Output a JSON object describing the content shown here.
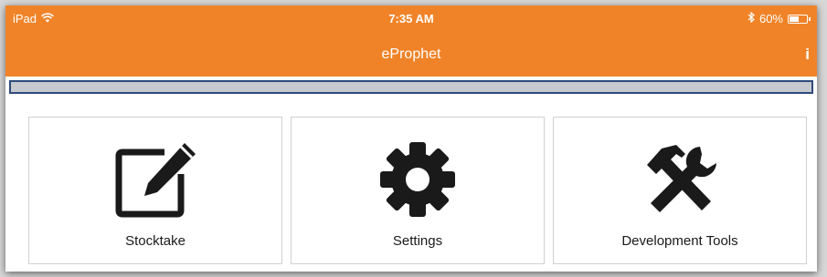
{
  "status": {
    "device": "iPad",
    "time": "7:35 AM",
    "battery_text": "60%",
    "battery_level": 0.6
  },
  "nav": {
    "title": "eProphet",
    "info_label": "i"
  },
  "tiles": [
    {
      "label": "Stocktake",
      "icon": "edit-icon"
    },
    {
      "label": "Settings",
      "icon": "gear-icon"
    },
    {
      "label": "Development Tools",
      "icon": "tools-icon"
    }
  ],
  "colors": {
    "accent": "#f08328",
    "search_border": "#2f4a7c"
  }
}
